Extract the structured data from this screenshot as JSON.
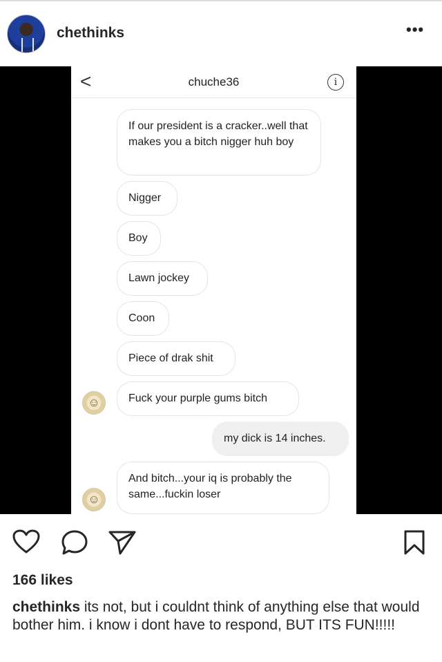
{
  "post": {
    "username": "chethinks",
    "more_label": "•••",
    "likes": "166 likes",
    "caption_user": "chethinks",
    "caption_text": " its not, but i couldnt think of anything else that would bother him. i know i dont have to respond, BUT ITS FUN!!!!!"
  },
  "dm": {
    "back_label": "<",
    "title": "chuche36",
    "info_label": "i",
    "messages": [
      {
        "from": "other",
        "text": "If our president is a cracker..well that makes you a bitch nigger huh boy"
      },
      {
        "from": "other",
        "text": "Nigger"
      },
      {
        "from": "other",
        "text": "Boy"
      },
      {
        "from": "other",
        "text": "Lawn jockey"
      },
      {
        "from": "other",
        "text": "Coon"
      },
      {
        "from": "other",
        "text": "Piece of drak shit"
      },
      {
        "from": "other",
        "text": "Fuck your purple gums bitch"
      },
      {
        "from": "me",
        "text": "my dick is 14 inches."
      },
      {
        "from": "other",
        "text": "And bitch...your iq is probably the same...fuckin loser"
      }
    ]
  },
  "icons": {
    "like": "heart-icon",
    "comment": "comment-icon",
    "share": "send-icon",
    "save": "bookmark-icon"
  }
}
